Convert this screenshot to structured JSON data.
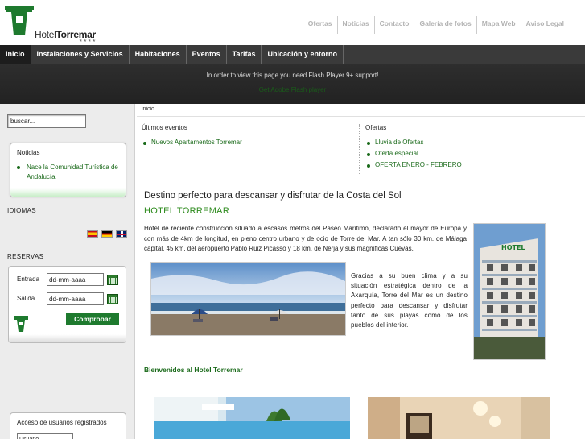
{
  "header": {
    "logo_word1": "Hotel",
    "logo_word2": "Torremar",
    "logo_stars": "★★★★",
    "links": [
      "Ofertas",
      "Noticias",
      "Contacto",
      "Galería de fotos",
      "Mapa Web",
      "Aviso Legal"
    ]
  },
  "nav": {
    "items": [
      "Inicio",
      "Instalaciones y Servicios",
      "Habitaciones",
      "Eventos",
      "Tarifas",
      "Ubicación y entorno"
    ]
  },
  "flash": {
    "message": "In order to view this page you need Flash Player 9+ support!",
    "link": "Get Adobe Flash player"
  },
  "sidebar": {
    "search_value": "buscar...",
    "noticias_title": "Noticias",
    "noticias_item": "Nace la Comunidad Turística de Andalucía",
    "idiomas_label": "IDIOMAS",
    "reservas_label": "RESERVAS",
    "entrada_label": "Entrada",
    "entrada_value": "dd-mm-aaaa",
    "salida_label": "Salida",
    "salida_value": "dd-mm-aaaa",
    "comprobar_label": "Comprobar",
    "login_title": "Acceso de usuarios registrados",
    "login_user_value": "Usuario"
  },
  "content": {
    "breadcrumb": "inicio",
    "events_title": "Últimos eventos",
    "events_items": [
      "Nuevos Apartamentos Torremar"
    ],
    "offers_title": "Ofertas",
    "offers_items": [
      "Lluvia de Ofertas",
      "Oferta especial",
      "OFERTA ENERO - FEBRERO"
    ],
    "headline": "Destino perfecto para descansar y disfrutar de la Costa del Sol",
    "hotel_name": "HOTEL TORREMAR",
    "intro": "Hotel de reciente construcción situado a escasos metros del Paseo Marítimo, declarado el mayor de Europa y con más de 4km de longitud, en pleno centro urbano y de ocio de Torre del Mar. A tan sólo 30 km. de Málaga capital, 45 km. del aeropuerto Pablo Ruiz Picasso y 18 km. de Nerja y sus magníficas Cuevas.",
    "para2": "Gracias a su buen clima y a su situación estratégica dentro de la Axarquía, Torre del Mar es un destino perfecto para descansar y disfrutar tanto de sus playas como de los pueblos del interior.",
    "building_sign": "HOTEL",
    "welcome": "Bienvenidos al Hotel Torremar"
  },
  "colors": {
    "brand_green": "#1a6a1a",
    "nav_bg": "#3a3a3a",
    "hotel_name_green": "#2e8b1e"
  }
}
